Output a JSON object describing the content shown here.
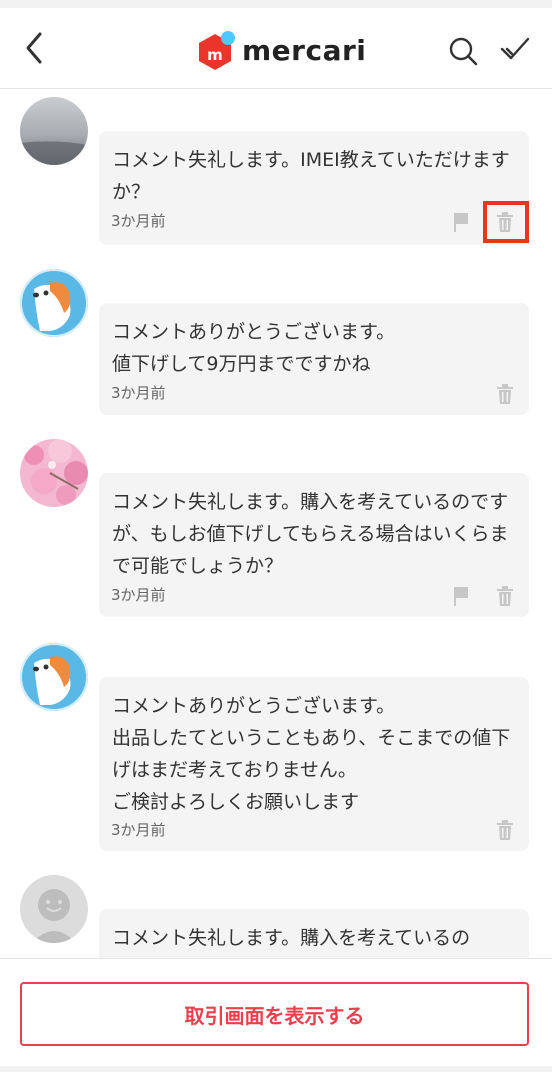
{
  "header": {
    "logo_text": "mercari",
    "colors": {
      "brand_red": "#ea352d",
      "brand_blue": "#4dc9ff"
    }
  },
  "comments": [
    {
      "text": "コメント失礼します。IMEI教えていただけますか？",
      "time": "3か月前",
      "avatar": "misty-landscape",
      "flag": true,
      "highlighted": true
    },
    {
      "text": "コメントありがとうございます。\n値下げして9万円までですかね",
      "time": "3か月前",
      "avatar": "dog-illustration",
      "flag": false
    },
    {
      "text": "コメント失礼します。購入を考えているのですが、もしお値下げしてもらえる場合はいくらまで可能でしょうか？",
      "time": "3か月前",
      "avatar": "cherry-blossom",
      "flag": true
    },
    {
      "text": "コメントありがとうございます。\n出品したてということもあり、そこまでの値下げはまだ考えておりません。\nご検討よろしくお願いします",
      "time": "3か月前",
      "avatar": "dog-illustration",
      "flag": false
    },
    {
      "text": "コメント失礼します。購入を考えているの",
      "time": "",
      "avatar": "default-face",
      "flag": false
    }
  ],
  "footer": {
    "cta_label": "取引画面を表示する",
    "cta_color": "#ea3f4c"
  }
}
